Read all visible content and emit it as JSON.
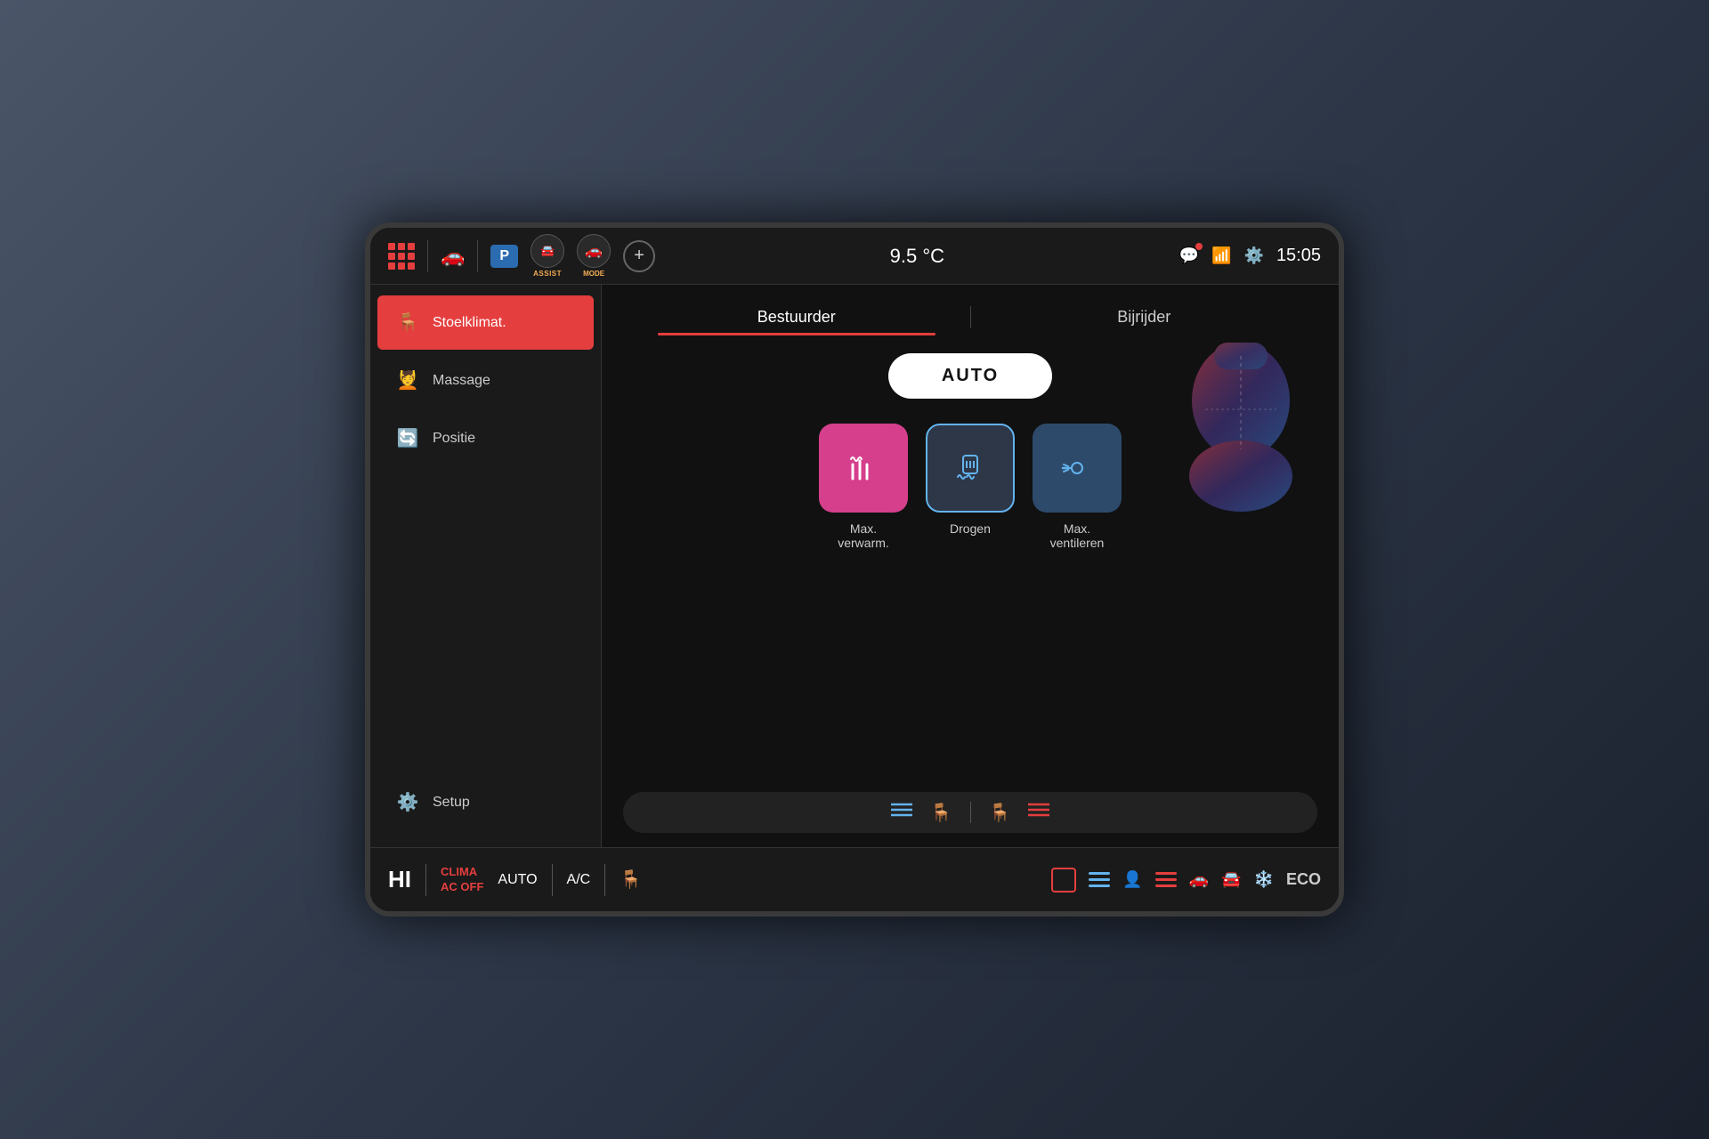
{
  "screen": {
    "statusBar": {
      "temperature": "9.5 °C",
      "time": "15:05",
      "assistLabel": "ASSIST",
      "modeLabel": "MODE",
      "parkingLabel": "P"
    },
    "sidebar": {
      "items": [
        {
          "id": "stoelklimat",
          "label": "Stoelklimat.",
          "active": true
        },
        {
          "id": "massage",
          "label": "Massage",
          "active": false
        },
        {
          "id": "positie",
          "label": "Positie",
          "active": false
        }
      ],
      "setup": {
        "label": "Setup"
      }
    },
    "tabs": [
      {
        "id": "bestuurder",
        "label": "Bestuurder",
        "active": true
      },
      {
        "id": "bijrijder",
        "label": "Bijrijder",
        "active": false
      }
    ],
    "autoButton": {
      "label": "AUTO"
    },
    "modeButtons": [
      {
        "id": "max-verwarm",
        "label1": "Max.",
        "label2": "verwarm.",
        "type": "heat"
      },
      {
        "id": "drogen",
        "label1": "Drogen",
        "label2": "",
        "type": "dry"
      },
      {
        "id": "max-ventileren",
        "label1": "Max.",
        "label2": "ventileren",
        "type": "ventilate"
      }
    ],
    "bottomBar": {
      "hiLabel": "HI",
      "climaLabel": "CLIMA",
      "climaSub": "AC OFF",
      "autoLabel": "AUTO",
      "acLabel": "A/C",
      "ecoLabel": "ECO"
    }
  }
}
